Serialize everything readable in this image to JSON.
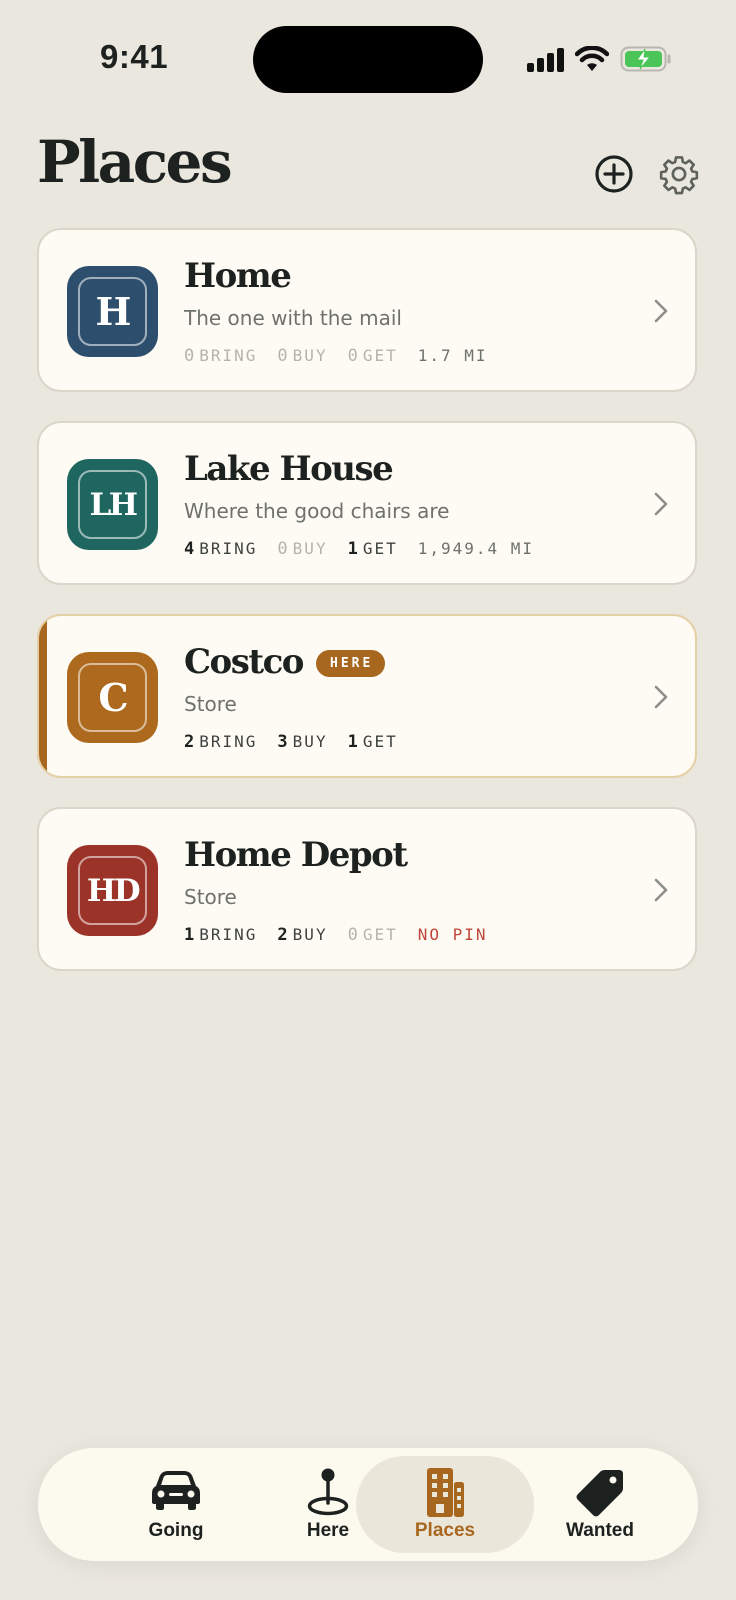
{
  "status_bar": {
    "time": "9:41"
  },
  "header": {
    "title": "Places"
  },
  "places": [
    {
      "monogram": "H",
      "name": "Home",
      "subtitle": "The one with the mail",
      "tile_color": "#2e4e6e",
      "stats": {
        "bring": 0,
        "buy": 0,
        "get": 0
      },
      "bring_label": "BRING",
      "buy_label": "BUY",
      "get_label": "GET",
      "extra": "1.7 MI"
    },
    {
      "monogram": "LH",
      "name": "Lake House",
      "subtitle": "Where the good chairs are",
      "tile_color": "#1f6660",
      "stats": {
        "bring": 4,
        "buy": 0,
        "get": 1
      },
      "bring_label": "BRING",
      "buy_label": "BUY",
      "get_label": "GET",
      "extra": "1,949.4 MI"
    },
    {
      "monogram": "C",
      "name": "Costco",
      "subtitle": "Store",
      "badge": "HERE",
      "tile_color": "#ad6a1e",
      "stats": {
        "bring": 2,
        "buy": 3,
        "get": 1
      },
      "bring_label": "BRING",
      "buy_label": "BUY",
      "get_label": "GET",
      "extra": ""
    },
    {
      "monogram": "HD",
      "name": "Home Depot",
      "subtitle": "Store",
      "tile_color": "#9b3328",
      "stats": {
        "bring": 1,
        "buy": 2,
        "get": 0
      },
      "bring_label": "BRING",
      "buy_label": "BUY",
      "get_label": "GET",
      "extra": "NO PIN"
    }
  ],
  "tabs": [
    {
      "label": "Going",
      "icon": "car-icon"
    },
    {
      "label": "Here",
      "icon": "map-pin-icon"
    },
    {
      "label": "Places",
      "icon": "building-icon"
    },
    {
      "label": "Wanted",
      "icon": "tag-icon"
    }
  ],
  "colors": {
    "accent": "#a8671e",
    "background": "#eae7df",
    "card": "#fdfbf4",
    "warning": "#c0473b"
  }
}
